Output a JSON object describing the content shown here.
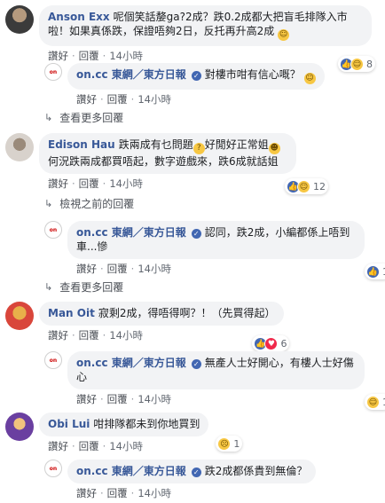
{
  "actions": {
    "like": "讚好",
    "reply": "回覆"
  },
  "comments": [
    {
      "name": "Anson Exx",
      "text": "呢個笑話嫠ga?2成？跌0.2成都大把盲毛排隊入市啦！如果真係跌，保證唔夠2日，反托再升高2成",
      "time": "14小時",
      "reactions_count": "8",
      "reply": {
        "name": "on.cc 東網／東方日報",
        "text": "對樓市咁有信心嘅？",
        "time": "14小時"
      },
      "more": "查看更多回覆"
    },
    {
      "name": "Edison Hau",
      "text": "跌兩成有乜問題",
      "text2": "好閒好正常姐",
      "text3": "何況跌兩成都買唔起，數字遊戲來，跌6成就話姐",
      "time": "14小時",
      "reactions_count": "12",
      "prev": "檢視之前的回覆",
      "reply": {
        "name": "on.cc 東網／東方日報",
        "text": "認同，跌2成，小編都係上唔到車...慘",
        "time": "14小時",
        "reactions_count": "1"
      },
      "more": "查看更多回覆"
    },
    {
      "name": "Man Oit",
      "text": "寂剩2成，得唔得啊？！（先買得起）",
      "time": "14小時",
      "reactions_count": "6",
      "reply": {
        "name": "on.cc 東網／東方日報",
        "text": "無產人士好開心，有樓人士好傷心",
        "time": "14小時",
        "reactions_count": "1"
      }
    },
    {
      "name": "Obi Lui",
      "text": "咁排隊都未到你地買到",
      "time": "14小時",
      "reactions_count": "1",
      "reply": {
        "name": "on.cc 東網／東方日報",
        "text": "跌2成都係貴到無倫？",
        "time": "14小時"
      }
    }
  ],
  "colors": {
    "link": "#385898",
    "bubble": "#f2f3f5",
    "like": "#4267b2"
  }
}
